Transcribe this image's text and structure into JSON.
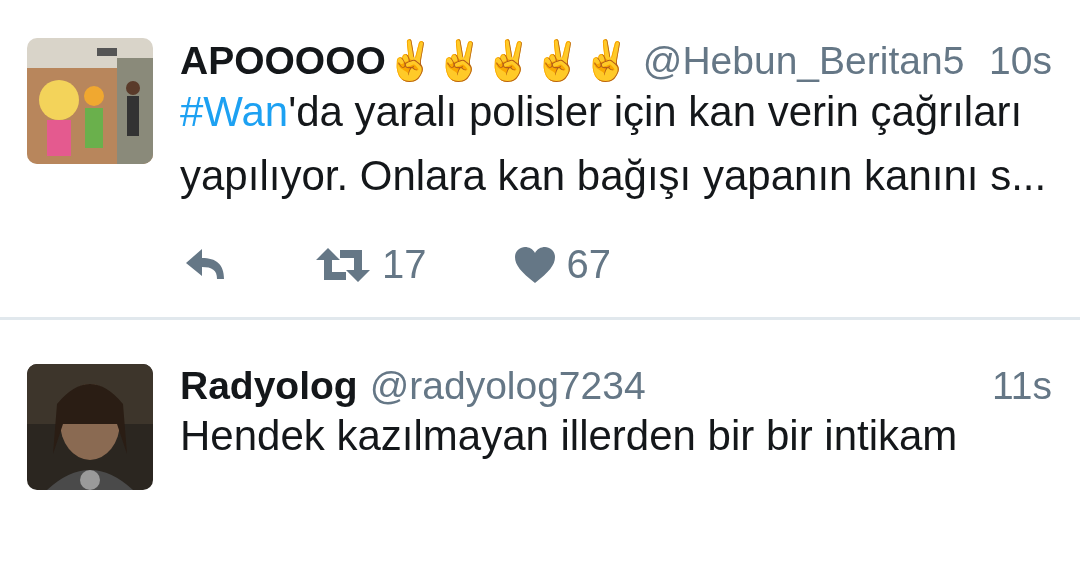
{
  "tweets": [
    {
      "name": "APOOOOO✌✌✌✌✌",
      "handle": "@Hebun_Beritan5",
      "time": "10s",
      "text": "'da yaralı polisler için kan verin çağrıları yapılıyor. Onlara kan bağışı yapanın kanını s...",
      "hashtag": "#Wan",
      "actions": {
        "retweets": "17",
        "likes": "67"
      }
    },
    {
      "name": "Radyolog",
      "handle": "@radyolog7234",
      "time": "11s",
      "text": "Hendek kazılmayan illerden bir bir intikam"
    }
  ]
}
